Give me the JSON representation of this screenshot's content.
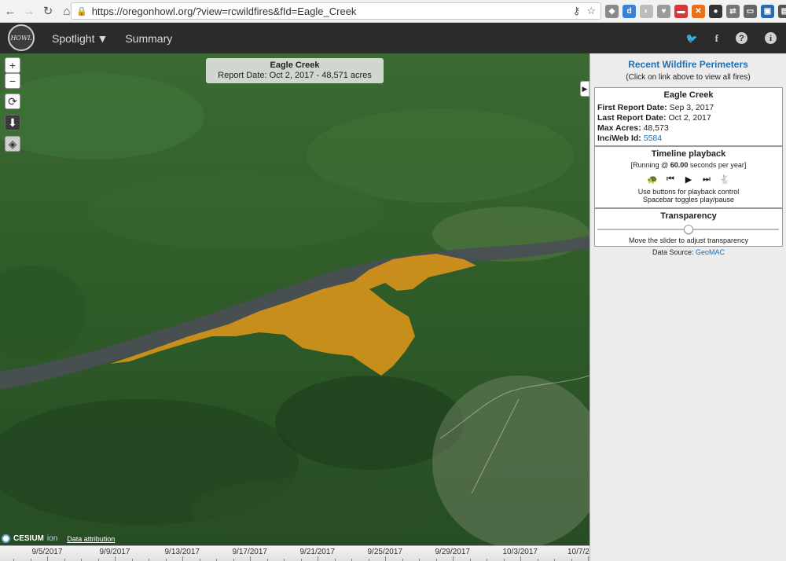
{
  "browser": {
    "url": "https://oregonhowl.org/?view=rcwildfires&fId=Eagle_Creek"
  },
  "header": {
    "logo_text": "HOWL",
    "nav": [
      {
        "label": "Spotlight",
        "has_caret": true
      },
      {
        "label": "Summary",
        "has_caret": false
      }
    ],
    "icons": [
      "twitter-icon",
      "facebook-icon",
      "help-icon",
      "info-icon"
    ],
    "twitter_glyph": "🐦",
    "facebook_glyph": "f",
    "help_glyph": "?",
    "info_glyph": "i"
  },
  "map": {
    "info_title": "Eagle Creek",
    "info_subtitle": "Report Date: Oct 2, 2017 - 48,571 acres",
    "zoom_in": "+",
    "zoom_out": "−",
    "colors": {
      "fire": "#d6921a",
      "river": "#4a4e55",
      "forest": "#2f5a2a"
    },
    "cesium_brand": "CESIUM",
    "cesium_ion": "ion",
    "attribution": "Data attribution",
    "timeline_labels": [
      "9/5/2017",
      "9/9/2017",
      "9/13/2017",
      "9/17/2017",
      "9/21/2017",
      "9/25/2017",
      "9/29/2017",
      "10/3/2017",
      "10/7/2"
    ]
  },
  "sidebar": {
    "title": "Recent Wildfire Perimeters",
    "subtitle": "(Click on link above to view all fires)",
    "fire": {
      "name": "Eagle Creek",
      "first_label": "First Report Date:",
      "first_value": "Sep 3, 2017",
      "last_label": "Last Report Date:",
      "last_value": "Oct 2, 2017",
      "acres_label": "Max Acres:",
      "acres_value": "48,573",
      "inciweb_label": "InciWeb Id:",
      "inciweb_value": "5584"
    },
    "playback": {
      "title": "Timeline playback",
      "status_prefix": "[Running @ ",
      "status_value": "60.00",
      "status_suffix": " seconds per year]",
      "hint1": "Use buttons for playback control",
      "hint2": "Spacebar toggles play/pause"
    },
    "transparency": {
      "title": "Transparency",
      "value": 0.5,
      "hint": "Move the slider to adjust transparency"
    },
    "data_source_label": "Data Source:",
    "data_source_link": "GeoMAC"
  }
}
